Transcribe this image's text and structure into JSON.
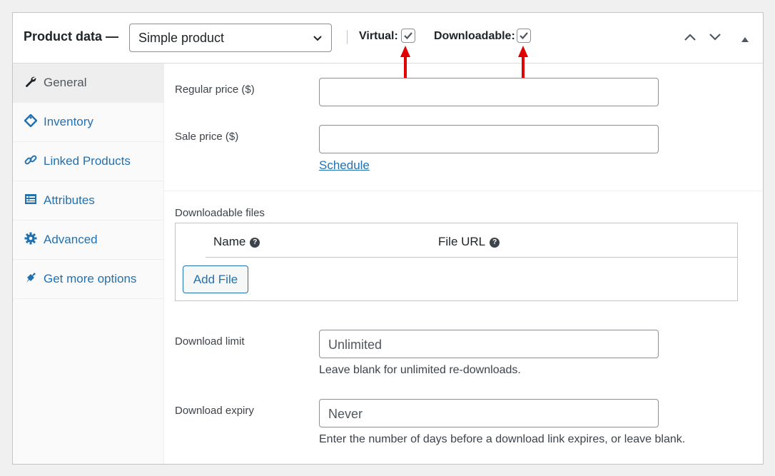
{
  "header": {
    "title": "Product data —",
    "product_type": "Simple product",
    "virtual_label": "Virtual:",
    "virtual_checked": true,
    "downloadable_label": "Downloadable:",
    "downloadable_checked": true
  },
  "sidebar": {
    "items": [
      {
        "label": "General",
        "icon": "wrench-icon",
        "active": true
      },
      {
        "label": "Inventory",
        "icon": "tag-icon",
        "active": false
      },
      {
        "label": "Linked Products",
        "icon": "link-icon",
        "active": false
      },
      {
        "label": "Attributes",
        "icon": "list-card-icon",
        "active": false
      },
      {
        "label": "Advanced",
        "icon": "gear-icon",
        "active": false
      },
      {
        "label": "Get more options",
        "icon": "plugin-icon",
        "active": false
      }
    ]
  },
  "general": {
    "regular_price_label": "Regular price ($)",
    "regular_price_value": "",
    "sale_price_label": "Sale price ($)",
    "sale_price_value": "",
    "schedule_link": "Schedule",
    "downloadable_files_label": "Downloadable files",
    "table_headers": [
      "Name",
      "File URL"
    ],
    "help_glyph": "?",
    "add_file_button": "Add File",
    "download_limit_label": "Download limit",
    "download_limit_placeholder": "Unlimited",
    "download_limit_hint": "Leave blank for unlimited re-downloads.",
    "download_expiry_label": "Download expiry",
    "download_expiry_placeholder": "Never",
    "download_expiry_hint": "Enter the number of days before a download link expires, or leave blank."
  },
  "colors": {
    "link": "#2271b1",
    "annotation_arrow": "#e00000"
  }
}
